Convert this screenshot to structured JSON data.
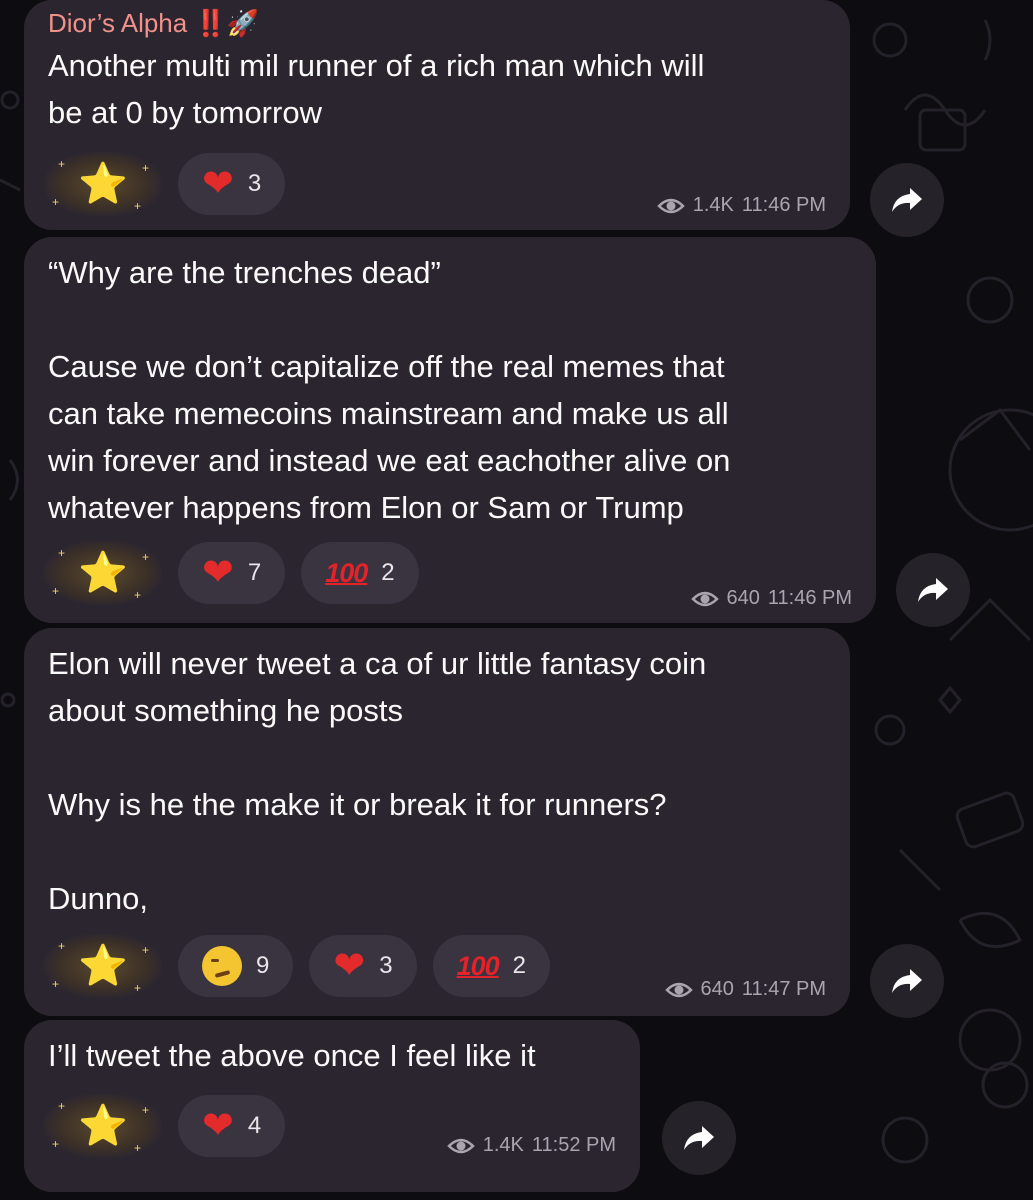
{
  "messages": [
    {
      "sender": "Dior’s Alpha ‼️🚀",
      "text": "Another multi mil runner of a rich man which will\nbe at 0 by tomorrow",
      "reactions": [
        {
          "icon": "star-icon",
          "count": ""
        },
        {
          "icon": "heart-icon",
          "glyph": "❤",
          "count": "3"
        }
      ],
      "views": "1.4K",
      "time": "11:46 PM"
    },
    {
      "text": "“Why are the trenches dead”\n\nCause we don’t capitalize off the real memes that\ncan take memecoins mainstream and make us all\nwin forever and instead we eat eachother alive on\nwhatever happens from Elon or Sam or Trump",
      "reactions": [
        {
          "icon": "star-icon",
          "count": ""
        },
        {
          "icon": "heart-icon",
          "glyph": "❤",
          "count": "7"
        },
        {
          "icon": "hundred-points-icon",
          "glyph": "100",
          "count": "2"
        }
      ],
      "views": "640",
      "time": "11:46 PM"
    },
    {
      "text": "Elon will never tweet a ca of ur little fantasy coin\nabout something he posts\n\nWhy is he the make it or break it for runners?\n\nDunno,",
      "reactions": [
        {
          "icon": "star-icon",
          "count": ""
        },
        {
          "icon": "woozy-face-icon",
          "count": "9"
        },
        {
          "icon": "heart-icon",
          "glyph": "❤",
          "count": "3"
        },
        {
          "icon": "hundred-points-icon",
          "glyph": "100",
          "count": "2"
        }
      ],
      "views": "640",
      "time": "11:47 PM"
    },
    {
      "text": "I’ll tweet the above once I feel like it",
      "reactions": [
        {
          "icon": "star-icon",
          "count": ""
        },
        {
          "icon": "heart-icon",
          "glyph": "❤",
          "count": "4"
        }
      ],
      "views": "1.4K",
      "time": "11:52 PM"
    }
  ],
  "icons": {
    "star": "⭐",
    "share": "share-arrow-icon",
    "views": "eye-icon"
  },
  "colors": {
    "background": "#0d0c10",
    "bubble": "#2b2530",
    "sender": "#f0918a",
    "pill": "#3a3440",
    "heart": "#e32b2b",
    "meta": "#a9a4ae"
  }
}
